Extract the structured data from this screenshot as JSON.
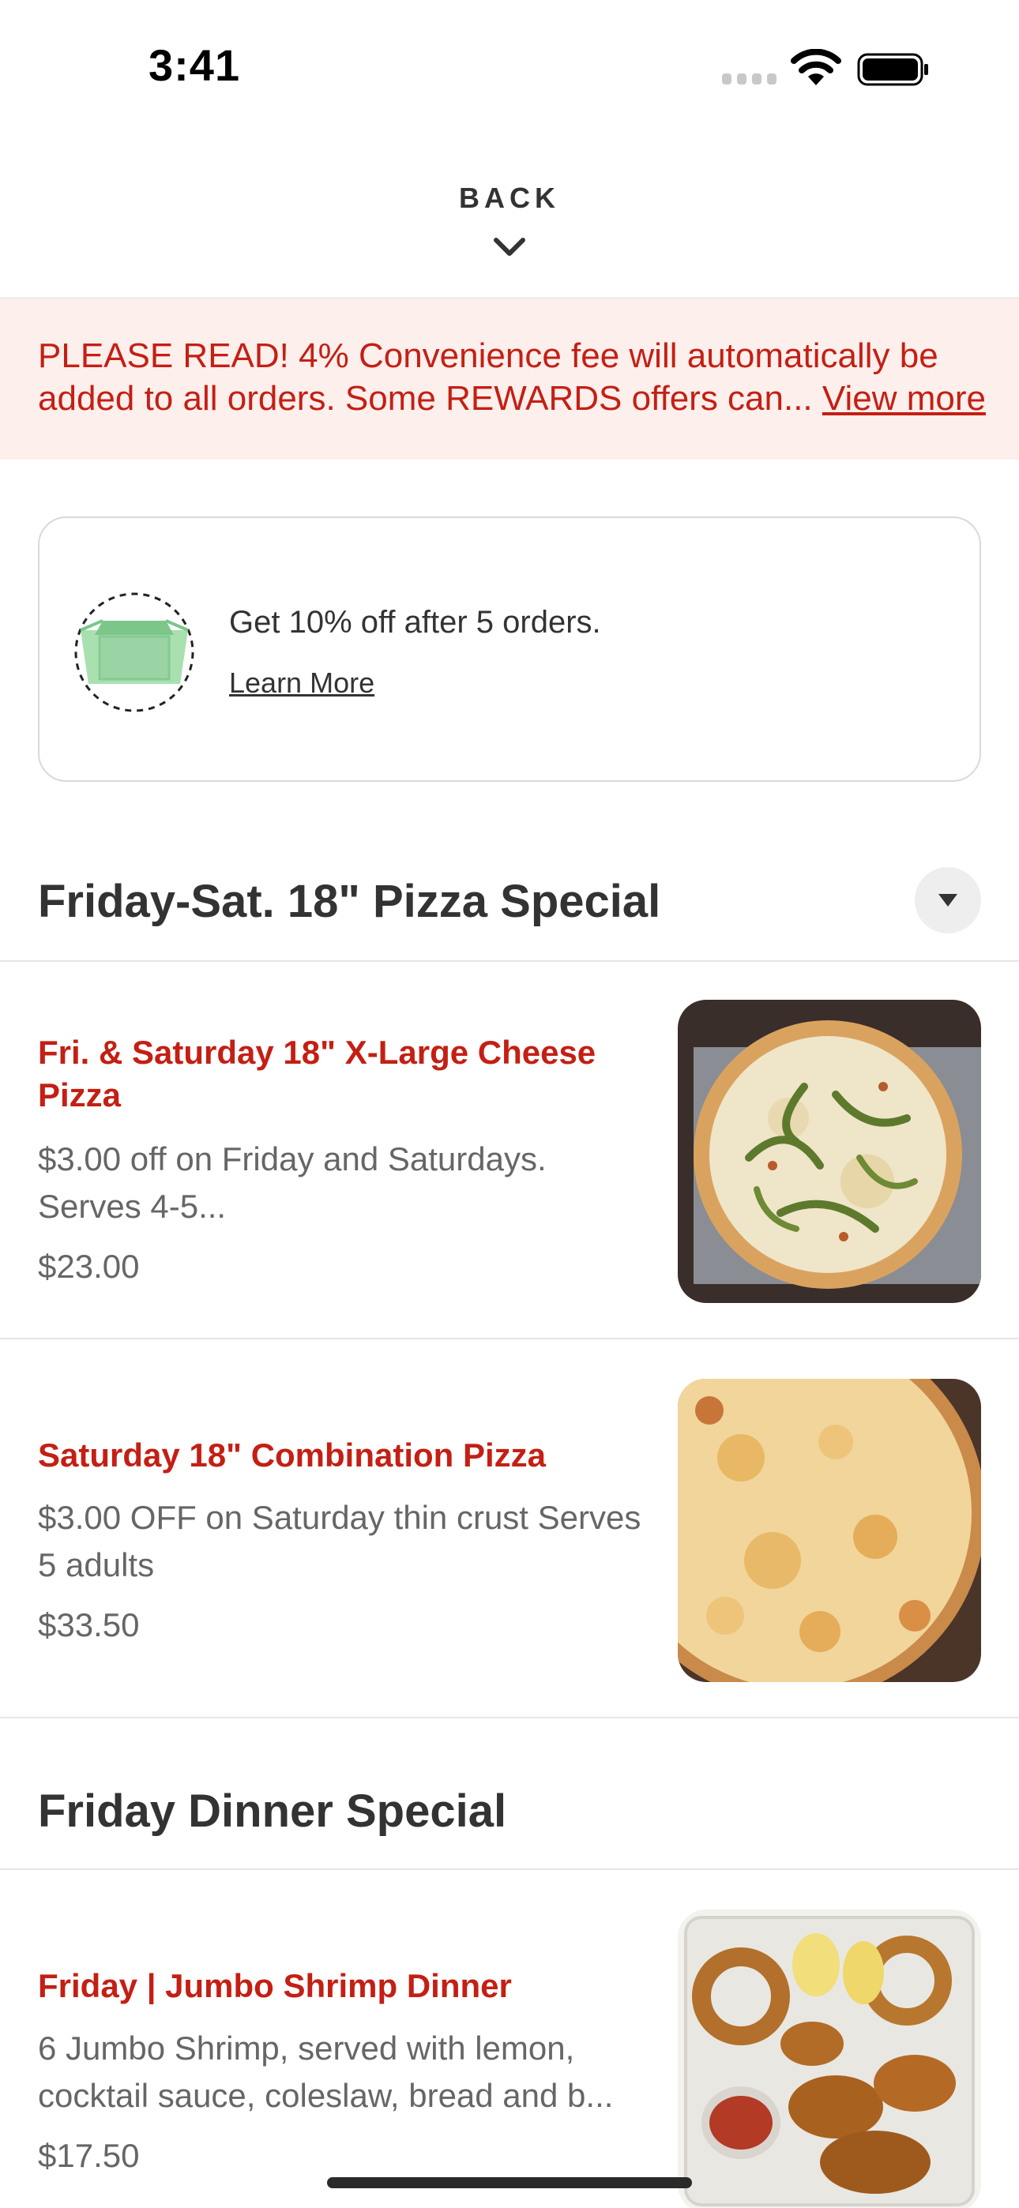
{
  "status_bar": {
    "time": "3:41"
  },
  "header": {
    "back_label": "BACK"
  },
  "notice": {
    "text": "PLEASE READ! 4% Convenience fee will automatically be added to all orders. Some REWARDS offers can...",
    "link_label": "View more",
    "text_color": "#c41f14",
    "background_color": "#fdefec"
  },
  "rewards": {
    "text": "Get 10% off after 5 orders.",
    "link_label": "Learn More",
    "icon": "takeout-box-icon"
  },
  "sections": [
    {
      "title": "Friday-Sat. 18\" Pizza Special",
      "toggle_icon": "caret-down-icon",
      "items": [
        {
          "name": "Fri. & Saturday 18\" X-Large Cheese Pizza",
          "description": "$3.00 off on Friday and Saturdays. Serves 4-5...",
          "price": "$23.00",
          "image": "pizza-photo"
        },
        {
          "name": "Saturday 18\" Combination Pizza",
          "description": "$3.00 OFF on Saturday thin crust Serves 5 adults",
          "price": "$33.50",
          "image": "pizza-photo"
        }
      ]
    },
    {
      "title": "Friday Dinner Special",
      "items": [
        {
          "name": "Friday | Jumbo Shrimp Dinner",
          "description": "6 Jumbo Shrimp, served with lemon, cocktail sauce, coleslaw, bread and b...",
          "price": "$17.50",
          "image": "shrimp-dinner-photo"
        }
      ]
    }
  ],
  "colors": {
    "accent": "#c41f14",
    "text_primary": "#333333",
    "text_secondary": "#666666",
    "divider": "#e6e6e6"
  }
}
